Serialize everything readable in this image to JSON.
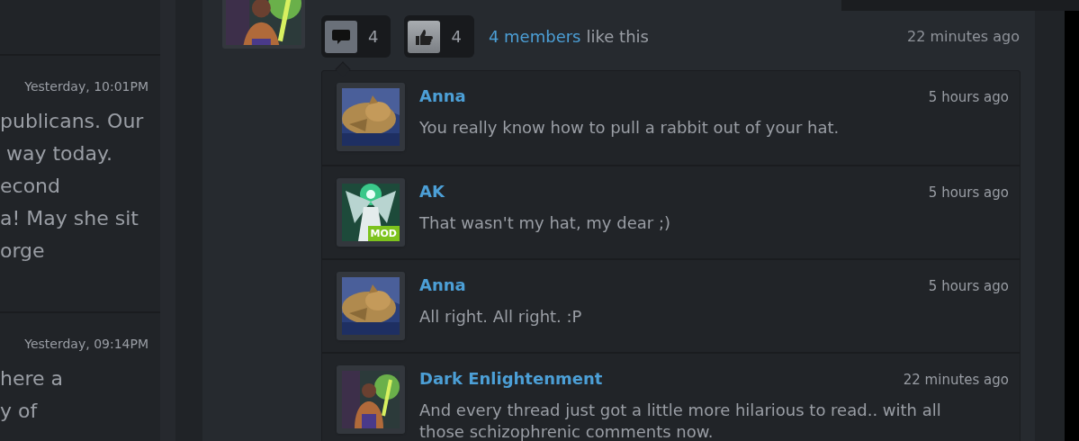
{
  "left_column": [
    {
      "time": "Yesterday, 10:01PM",
      "texts": [
        "publicans. Our",
        " way today.",
        "econd",
        "a! May she sit",
        "orge"
      ]
    },
    {
      "time": "Yesterday, 09:14PM",
      "texts": [
        "here a",
        "y of"
      ]
    }
  ],
  "post": {
    "comment_button": {
      "count": "4"
    },
    "like_button": {
      "count": "4"
    },
    "likes_link": "4 members",
    "likes_text": "like this",
    "time": "22 minutes ago",
    "comments": [
      {
        "author": "Anna",
        "time": "5 hours ago",
        "text": "You really know how to pull a rabbit out of your hat."
      },
      {
        "author": "AK",
        "time": "5 hours ago",
        "text": "That wasn't my hat, my dear ;)",
        "badge": "MOD"
      },
      {
        "author": "Anna",
        "time": "5 hours ago",
        "text": "All right. All right. :P"
      },
      {
        "author": "Dark Enlightenment",
        "time": "22 minutes ago",
        "text": "And every thread just got a little more hilarious to read.. with all those schizophrenic comments now."
      }
    ]
  }
}
